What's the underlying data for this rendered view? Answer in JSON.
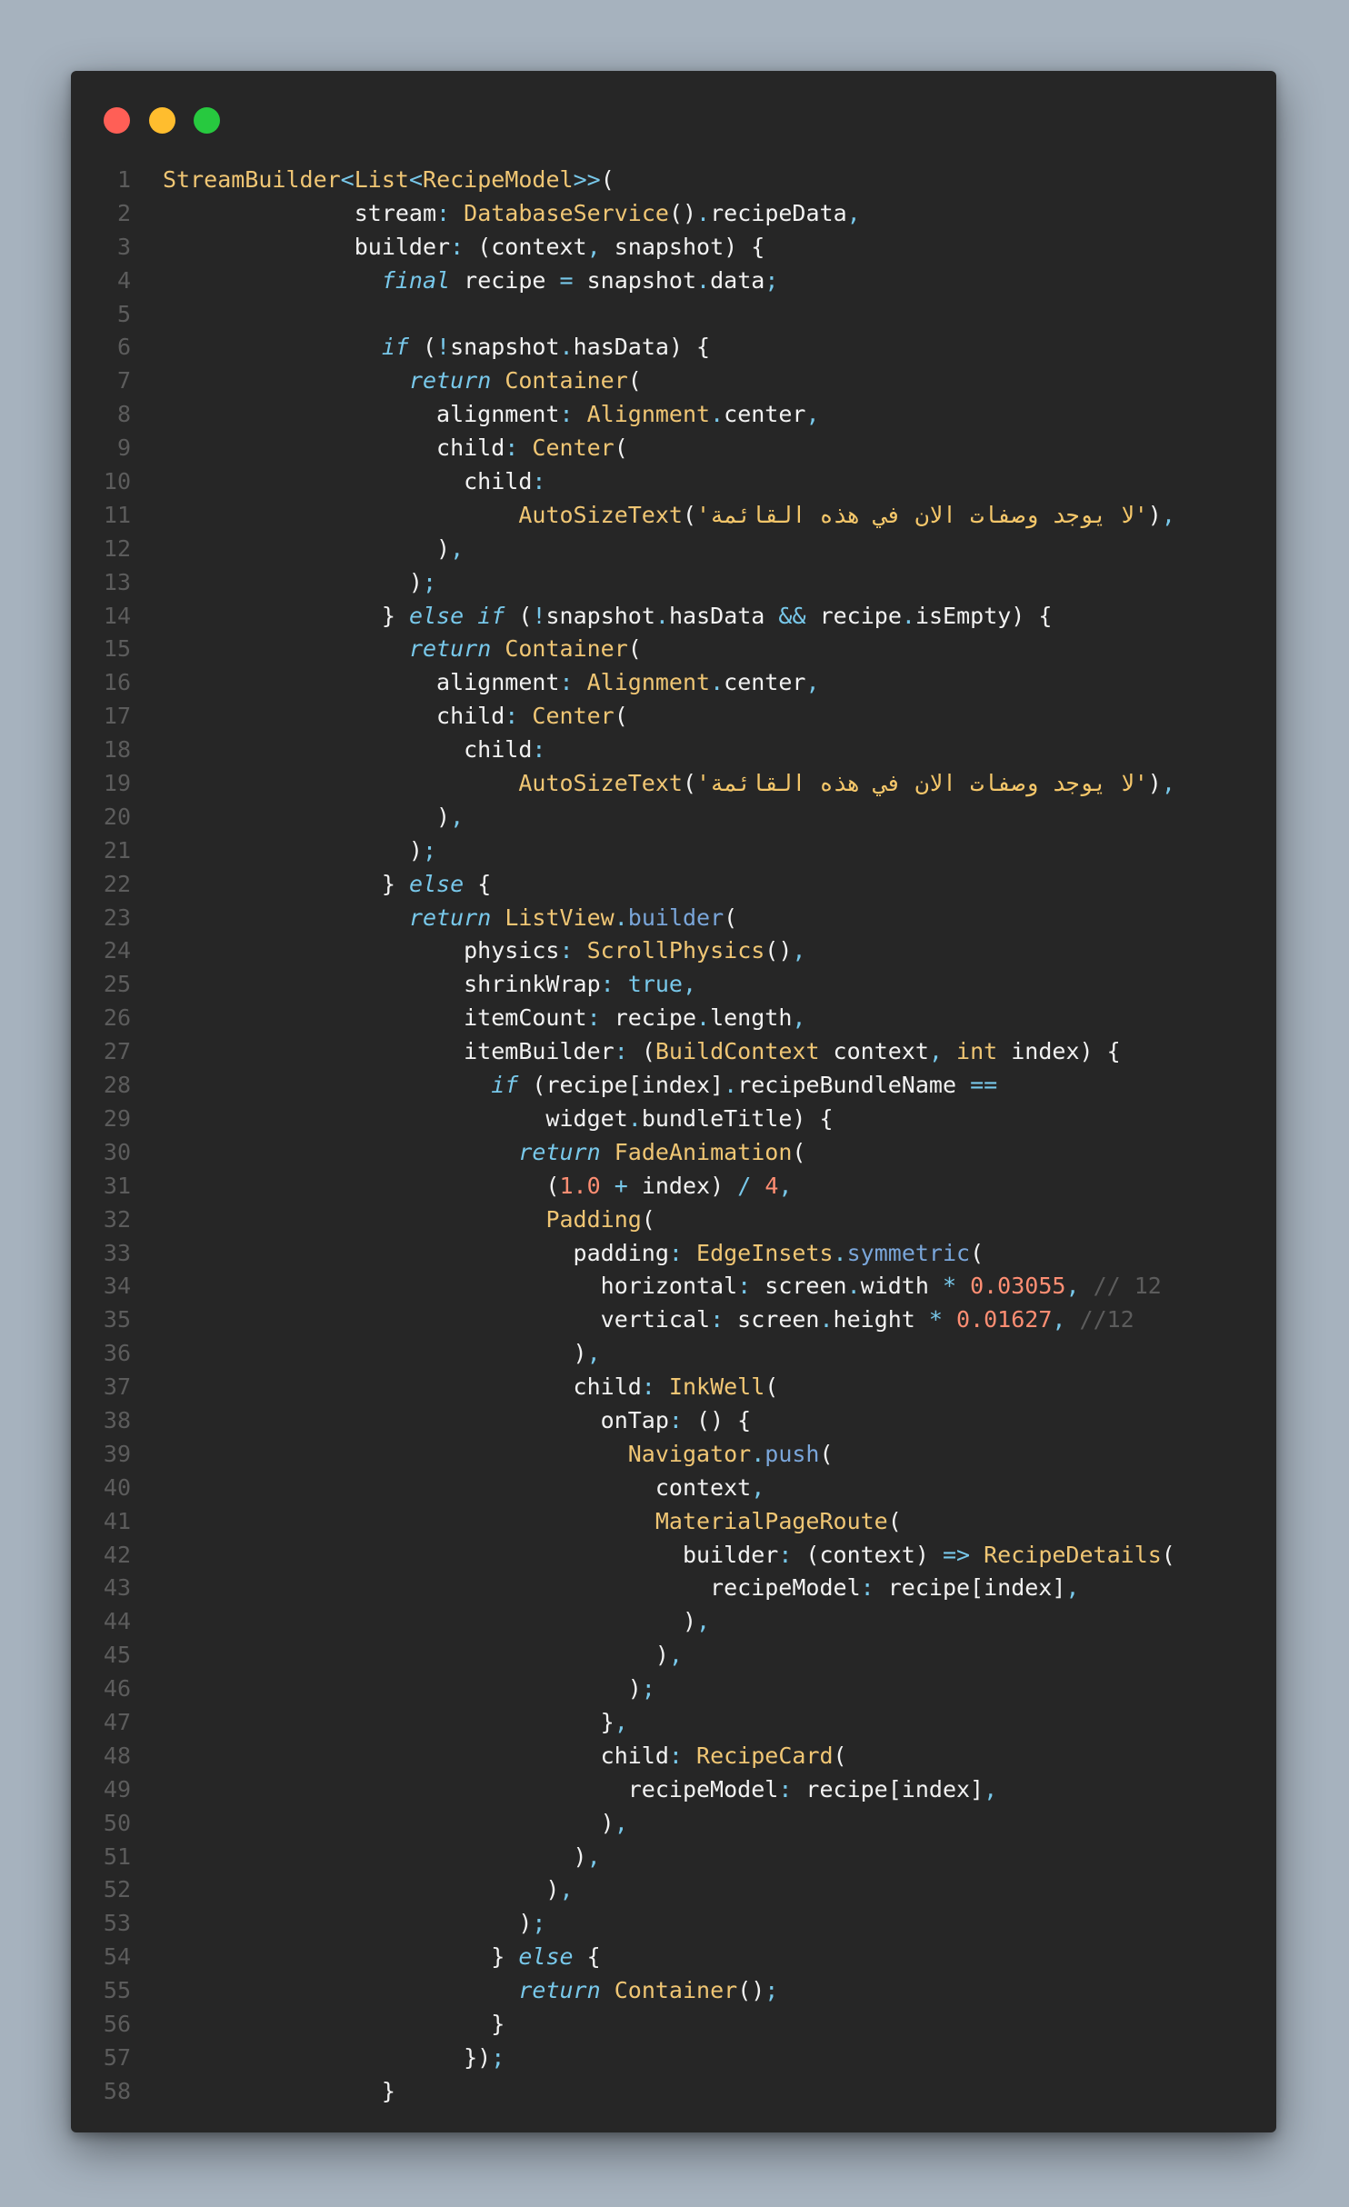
{
  "window": {
    "controls": [
      "close-dot",
      "minimize-dot",
      "zoom-dot"
    ],
    "colors": {
      "close": "#ff5f56",
      "minimize": "#ffbd2e",
      "zoom": "#27c93f"
    }
  },
  "code": {
    "language": "dart",
    "lines": [
      [
        [
          "cls",
          "StreamBuilder"
        ],
        [
          "op",
          "<"
        ],
        [
          "cls",
          "List"
        ],
        [
          "op",
          "<"
        ],
        [
          "cls",
          "RecipeModel"
        ],
        [
          "op",
          ">>"
        ],
        [
          "t",
          "("
        ]
      ],
      [
        [
          "t",
          "              stream"
        ],
        [
          "op",
          ":"
        ],
        [
          "t",
          " "
        ],
        [
          "cls",
          "DatabaseService"
        ],
        [
          "t",
          "()"
        ],
        [
          "op",
          "."
        ],
        [
          "t",
          "recipeData"
        ],
        [
          "op",
          ","
        ]
      ],
      [
        [
          "t",
          "              builder"
        ],
        [
          "op",
          ":"
        ],
        [
          "t",
          " (context"
        ],
        [
          "op",
          ","
        ],
        [
          "t",
          " snapshot) {"
        ]
      ],
      [
        [
          "t",
          "                "
        ],
        [
          "kw",
          "final"
        ],
        [
          "t",
          " recipe "
        ],
        [
          "op",
          "="
        ],
        [
          "t",
          " snapshot"
        ],
        [
          "op",
          "."
        ],
        [
          "t",
          "data"
        ],
        [
          "op",
          ";"
        ]
      ],
      [
        [
          "t",
          ""
        ]
      ],
      [
        [
          "t",
          "                "
        ],
        [
          "kw",
          "if"
        ],
        [
          "t",
          " ("
        ],
        [
          "op",
          "!"
        ],
        [
          "t",
          "snapshot"
        ],
        [
          "op",
          "."
        ],
        [
          "t",
          "hasData) {"
        ]
      ],
      [
        [
          "t",
          "                  "
        ],
        [
          "kw",
          "return"
        ],
        [
          "t",
          " "
        ],
        [
          "cls",
          "Container"
        ],
        [
          "t",
          "("
        ]
      ],
      [
        [
          "t",
          "                    alignment"
        ],
        [
          "op",
          ":"
        ],
        [
          "t",
          " "
        ],
        [
          "cls",
          "Alignment"
        ],
        [
          "op",
          "."
        ],
        [
          "t",
          "center"
        ],
        [
          "op",
          ","
        ]
      ],
      [
        [
          "t",
          "                    child"
        ],
        [
          "op",
          ":"
        ],
        [
          "t",
          " "
        ],
        [
          "cls",
          "Center"
        ],
        [
          "t",
          "("
        ]
      ],
      [
        [
          "t",
          "                      child"
        ],
        [
          "op",
          ":"
        ]
      ],
      [
        [
          "t",
          "                          "
        ],
        [
          "cls",
          "AutoSizeText"
        ],
        [
          "t",
          "("
        ],
        [
          "str",
          "'لا يوجد وصفات الان في هذه القائمة'"
        ],
        [
          "t",
          ")"
        ],
        [
          "op",
          ","
        ]
      ],
      [
        [
          "t",
          "                    )"
        ],
        [
          "op",
          ","
        ]
      ],
      [
        [
          "t",
          "                  )"
        ],
        [
          "op",
          ";"
        ]
      ],
      [
        [
          "t",
          "                } "
        ],
        [
          "kw",
          "else"
        ],
        [
          "t",
          " "
        ],
        [
          "kw",
          "if"
        ],
        [
          "t",
          " ("
        ],
        [
          "op",
          "!"
        ],
        [
          "t",
          "snapshot"
        ],
        [
          "op",
          "."
        ],
        [
          "t",
          "hasData "
        ],
        [
          "op",
          "&&"
        ],
        [
          "t",
          " recipe"
        ],
        [
          "op",
          "."
        ],
        [
          "t",
          "isEmpty) {"
        ]
      ],
      [
        [
          "t",
          "                  "
        ],
        [
          "kw",
          "return"
        ],
        [
          "t",
          " "
        ],
        [
          "cls",
          "Container"
        ],
        [
          "t",
          "("
        ]
      ],
      [
        [
          "t",
          "                    alignment"
        ],
        [
          "op",
          ":"
        ],
        [
          "t",
          " "
        ],
        [
          "cls",
          "Alignment"
        ],
        [
          "op",
          "."
        ],
        [
          "t",
          "center"
        ],
        [
          "op",
          ","
        ]
      ],
      [
        [
          "t",
          "                    child"
        ],
        [
          "op",
          ":"
        ],
        [
          "t",
          " "
        ],
        [
          "cls",
          "Center"
        ],
        [
          "t",
          "("
        ]
      ],
      [
        [
          "t",
          "                      child"
        ],
        [
          "op",
          ":"
        ]
      ],
      [
        [
          "t",
          "                          "
        ],
        [
          "cls",
          "AutoSizeText"
        ],
        [
          "t",
          "("
        ],
        [
          "str",
          "'لا يوجد وصفات الان في هذه القائمة'"
        ],
        [
          "t",
          ")"
        ],
        [
          "op",
          ","
        ]
      ],
      [
        [
          "t",
          "                    )"
        ],
        [
          "op",
          ","
        ]
      ],
      [
        [
          "t",
          "                  )"
        ],
        [
          "op",
          ";"
        ]
      ],
      [
        [
          "t",
          "                } "
        ],
        [
          "kw",
          "else"
        ],
        [
          "t",
          " {"
        ]
      ],
      [
        [
          "t",
          "                  "
        ],
        [
          "kw",
          "return"
        ],
        [
          "t",
          " "
        ],
        [
          "cls",
          "ListView"
        ],
        [
          "op",
          "."
        ],
        [
          "fn",
          "builder"
        ],
        [
          "t",
          "("
        ]
      ],
      [
        [
          "t",
          "                      physics"
        ],
        [
          "op",
          ":"
        ],
        [
          "t",
          " "
        ],
        [
          "cls",
          "ScrollPhysics"
        ],
        [
          "t",
          "()"
        ],
        [
          "op",
          ","
        ]
      ],
      [
        [
          "t",
          "                      shrinkWrap"
        ],
        [
          "op",
          ":"
        ],
        [
          "t",
          " "
        ],
        [
          "prm",
          "true"
        ],
        [
          "op",
          ","
        ]
      ],
      [
        [
          "t",
          "                      itemCount"
        ],
        [
          "op",
          ":"
        ],
        [
          "t",
          " recipe"
        ],
        [
          "op",
          "."
        ],
        [
          "t",
          "length"
        ],
        [
          "op",
          ","
        ]
      ],
      [
        [
          "t",
          "                      itemBuilder"
        ],
        [
          "op",
          ":"
        ],
        [
          "t",
          " ("
        ],
        [
          "cls",
          "BuildContext"
        ],
        [
          "t",
          " context"
        ],
        [
          "op",
          ","
        ],
        [
          "t",
          " "
        ],
        [
          "cls",
          "int"
        ],
        [
          "t",
          " index) {"
        ]
      ],
      [
        [
          "t",
          "                        "
        ],
        [
          "kw",
          "if"
        ],
        [
          "t",
          " (recipe[index]"
        ],
        [
          "op",
          "."
        ],
        [
          "t",
          "recipeBundleName "
        ],
        [
          "op",
          "=="
        ]
      ],
      [
        [
          "t",
          "                            widget"
        ],
        [
          "op",
          "."
        ],
        [
          "t",
          "bundleTitle) {"
        ]
      ],
      [
        [
          "t",
          "                          "
        ],
        [
          "kw",
          "return"
        ],
        [
          "t",
          " "
        ],
        [
          "cls",
          "FadeAnimation"
        ],
        [
          "t",
          "("
        ]
      ],
      [
        [
          "t",
          "                            ("
        ],
        [
          "num",
          "1.0"
        ],
        [
          "t",
          " "
        ],
        [
          "op",
          "+"
        ],
        [
          "t",
          " index) "
        ],
        [
          "op",
          "/"
        ],
        [
          "t",
          " "
        ],
        [
          "num",
          "4"
        ],
        [
          "op",
          ","
        ]
      ],
      [
        [
          "t",
          "                            "
        ],
        [
          "cls",
          "Padding"
        ],
        [
          "t",
          "("
        ]
      ],
      [
        [
          "t",
          "                              padding"
        ],
        [
          "op",
          ":"
        ],
        [
          "t",
          " "
        ],
        [
          "cls",
          "EdgeInsets"
        ],
        [
          "op",
          "."
        ],
        [
          "fn",
          "symmetric"
        ],
        [
          "t",
          "("
        ]
      ],
      [
        [
          "t",
          "                                horizontal"
        ],
        [
          "op",
          ":"
        ],
        [
          "t",
          " screen"
        ],
        [
          "op",
          "."
        ],
        [
          "t",
          "width "
        ],
        [
          "op",
          "*"
        ],
        [
          "t",
          " "
        ],
        [
          "num",
          "0.03055"
        ],
        [
          "op",
          ","
        ],
        [
          "t",
          " "
        ],
        [
          "cm",
          "// 12"
        ]
      ],
      [
        [
          "t",
          "                                vertical"
        ],
        [
          "op",
          ":"
        ],
        [
          "t",
          " screen"
        ],
        [
          "op",
          "."
        ],
        [
          "t",
          "height "
        ],
        [
          "op",
          "*"
        ],
        [
          "t",
          " "
        ],
        [
          "num",
          "0.01627"
        ],
        [
          "op",
          ","
        ],
        [
          "t",
          " "
        ],
        [
          "cm",
          "//12"
        ]
      ],
      [
        [
          "t",
          "                              )"
        ],
        [
          "op",
          ","
        ]
      ],
      [
        [
          "t",
          "                              child"
        ],
        [
          "op",
          ":"
        ],
        [
          "t",
          " "
        ],
        [
          "cls",
          "InkWell"
        ],
        [
          "t",
          "("
        ]
      ],
      [
        [
          "t",
          "                                onTap"
        ],
        [
          "op",
          ":"
        ],
        [
          "t",
          " () {"
        ]
      ],
      [
        [
          "t",
          "                                  "
        ],
        [
          "cls",
          "Navigator"
        ],
        [
          "op",
          "."
        ],
        [
          "fn",
          "push"
        ],
        [
          "t",
          "("
        ]
      ],
      [
        [
          "t",
          "                                    context"
        ],
        [
          "op",
          ","
        ]
      ],
      [
        [
          "t",
          "                                    "
        ],
        [
          "cls",
          "MaterialPageRoute"
        ],
        [
          "t",
          "("
        ]
      ],
      [
        [
          "t",
          "                                      builder"
        ],
        [
          "op",
          ":"
        ],
        [
          "t",
          " (context) "
        ],
        [
          "op",
          "=>"
        ],
        [
          "t",
          " "
        ],
        [
          "cls",
          "RecipeDetails"
        ],
        [
          "t",
          "("
        ]
      ],
      [
        [
          "t",
          "                                        recipeModel"
        ],
        [
          "op",
          ":"
        ],
        [
          "t",
          " recipe[index]"
        ],
        [
          "op",
          ","
        ]
      ],
      [
        [
          "t",
          "                                      )"
        ],
        [
          "op",
          ","
        ]
      ],
      [
        [
          "t",
          "                                    )"
        ],
        [
          "op",
          ","
        ]
      ],
      [
        [
          "t",
          "                                  )"
        ],
        [
          "op",
          ";"
        ]
      ],
      [
        [
          "t",
          "                                }"
        ],
        [
          "op",
          ","
        ]
      ],
      [
        [
          "t",
          "                                child"
        ],
        [
          "op",
          ":"
        ],
        [
          "t",
          " "
        ],
        [
          "cls",
          "RecipeCard"
        ],
        [
          "t",
          "("
        ]
      ],
      [
        [
          "t",
          "                                  recipeModel"
        ],
        [
          "op",
          ":"
        ],
        [
          "t",
          " recipe[index]"
        ],
        [
          "op",
          ","
        ]
      ],
      [
        [
          "t",
          "                                )"
        ],
        [
          "op",
          ","
        ]
      ],
      [
        [
          "t",
          "                              )"
        ],
        [
          "op",
          ","
        ]
      ],
      [
        [
          "t",
          "                            )"
        ],
        [
          "op",
          ","
        ]
      ],
      [
        [
          "t",
          "                          )"
        ],
        [
          "op",
          ";"
        ]
      ],
      [
        [
          "t",
          "                        } "
        ],
        [
          "kw",
          "else"
        ],
        [
          "t",
          " {"
        ]
      ],
      [
        [
          "t",
          "                          "
        ],
        [
          "kw",
          "return"
        ],
        [
          "t",
          " "
        ],
        [
          "cls",
          "Container"
        ],
        [
          "t",
          "()"
        ],
        [
          "op",
          ";"
        ]
      ],
      [
        [
          "t",
          "                        }"
        ]
      ],
      [
        [
          "t",
          "                      })"
        ],
        [
          "op",
          ";"
        ]
      ],
      [
        [
          "t",
          "                }"
        ]
      ]
    ]
  }
}
